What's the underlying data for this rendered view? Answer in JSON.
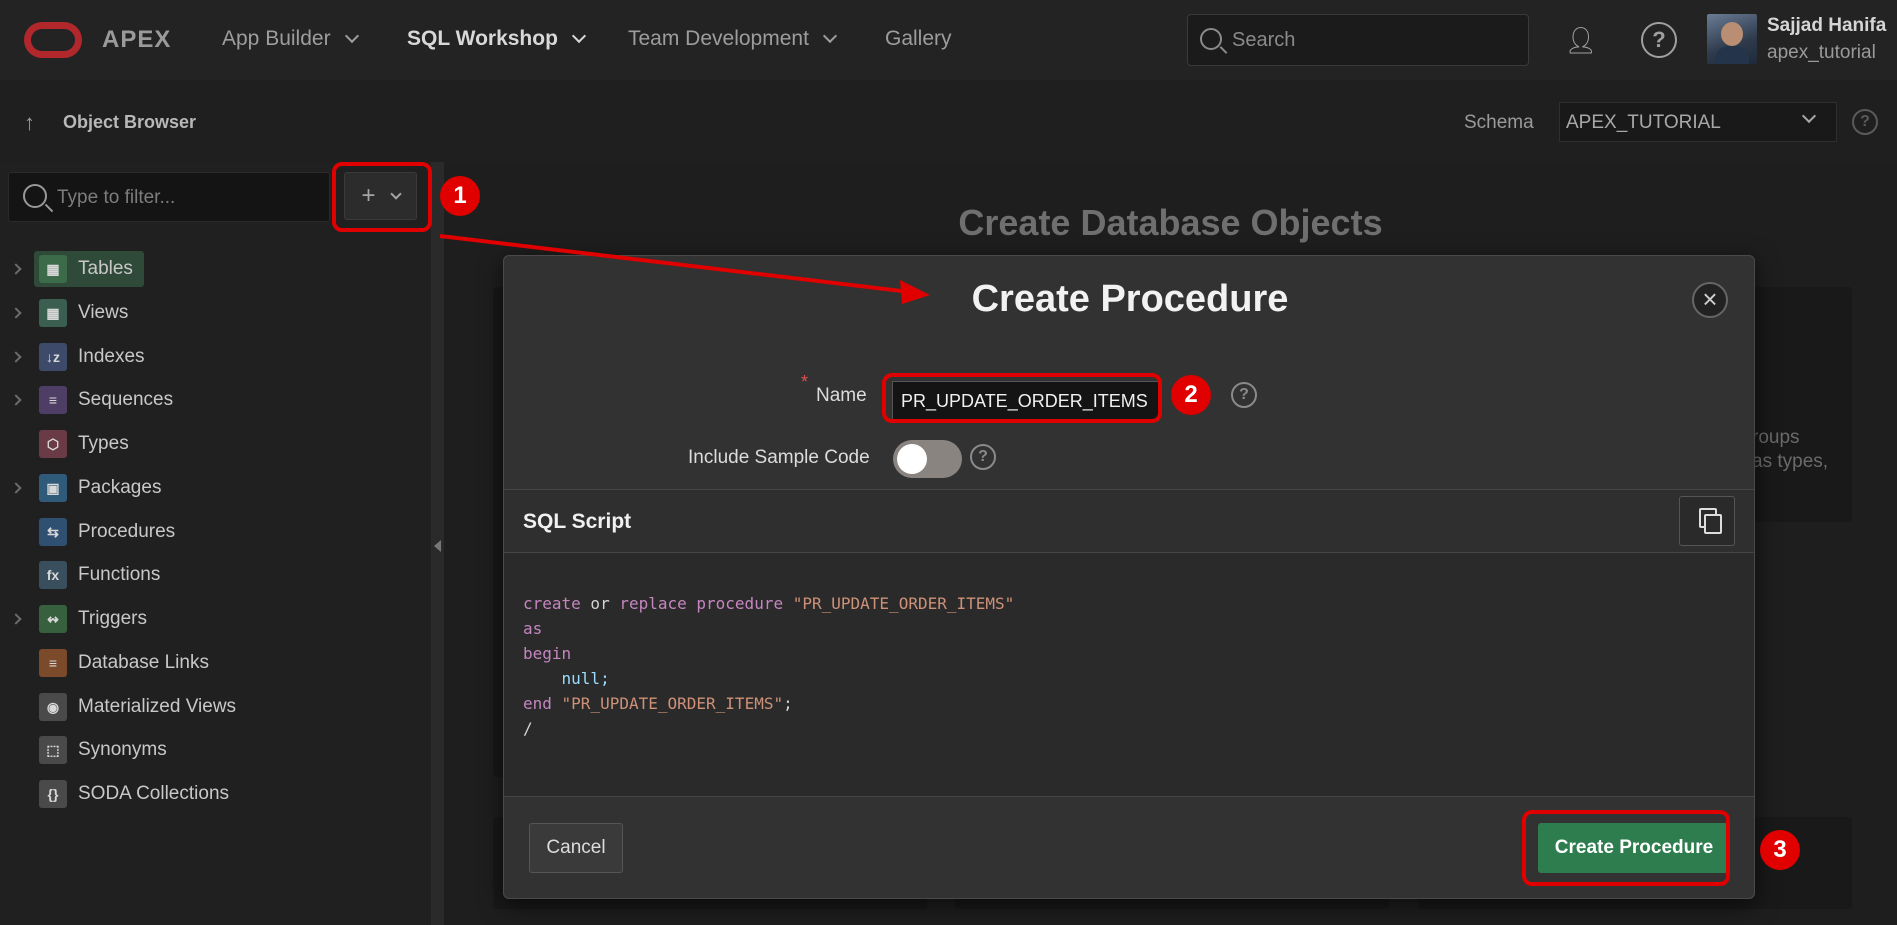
{
  "header": {
    "brand": "APEX",
    "nav": [
      {
        "label": "App Builder"
      },
      {
        "label": "SQL Workshop"
      },
      {
        "label": "Team Development"
      },
      {
        "label": "Gallery"
      }
    ],
    "search_placeholder": "Search",
    "user_name": "Sajjad Hanifa",
    "user_workspace": "apex_tutorial"
  },
  "subheader": {
    "title": "Object Browser",
    "schema_label": "Schema",
    "schema_value": "APEX_TUTORIAL"
  },
  "sidebar": {
    "filter_placeholder": "Type to filter...",
    "items": [
      {
        "label": "Tables",
        "icon": "table-icon",
        "color": "#3c6b4a"
      },
      {
        "label": "Views",
        "icon": "view-icon",
        "color": "#3a5e4f"
      },
      {
        "label": "Indexes",
        "icon": "index-icon",
        "color": "#3e4a6a"
      },
      {
        "label": "Sequences",
        "icon": "sequence-icon",
        "color": "#4e3e66"
      },
      {
        "label": "Types",
        "icon": "type-icon",
        "color": "#6a3a46"
      },
      {
        "label": "Packages",
        "icon": "package-icon",
        "color": "#2f5a7a"
      },
      {
        "label": "Procedures",
        "icon": "procedure-icon",
        "color": "#2f5070"
      },
      {
        "label": "Functions",
        "icon": "function-icon",
        "color": "#3a4f5e"
      },
      {
        "label": "Triggers",
        "icon": "trigger-icon",
        "color": "#37603f"
      },
      {
        "label": "Database Links",
        "icon": "database-link-icon",
        "color": "#7a4a2a"
      },
      {
        "label": "Materialized Views",
        "icon": "materialized-view-icon",
        "color": "#4a4a4a"
      },
      {
        "label": "Synonyms",
        "icon": "synonym-icon",
        "color": "#4a4a4a"
      },
      {
        "label": "SODA Collections",
        "icon": "soda-icon",
        "color": "#4a4a4a"
      }
    ]
  },
  "main": {
    "title": "Create Database Objects",
    "bg_text_1": "roups",
    "bg_text_2": "as types,"
  },
  "dialog": {
    "title": "Create Procedure",
    "name_label": "Name",
    "name_required": "*",
    "name_value": "PR_UPDATE_ORDER_ITEMS",
    "sample_label": "Include Sample Code",
    "sample_enabled": false,
    "sql_title": "SQL Script",
    "code": {
      "line1_kw1": "create",
      "line1_or": " or ",
      "line1_kw2": "replace procedure",
      "line1_str": " \"PR_UPDATE_ORDER_ITEMS\"",
      "line2": "as",
      "line3": "begin",
      "line4": "    null;",
      "line5_kw": "end",
      "line5_str": " \"PR_UPDATE_ORDER_ITEMS\"",
      "line5_end": ";",
      "line6": "/"
    },
    "cancel_label": "Cancel",
    "create_label": "Create Procedure"
  },
  "annotations": [
    "1",
    "2",
    "3"
  ],
  "colors": {
    "accent_green": "#2e7d4f",
    "annotation_red": "#e00000"
  }
}
